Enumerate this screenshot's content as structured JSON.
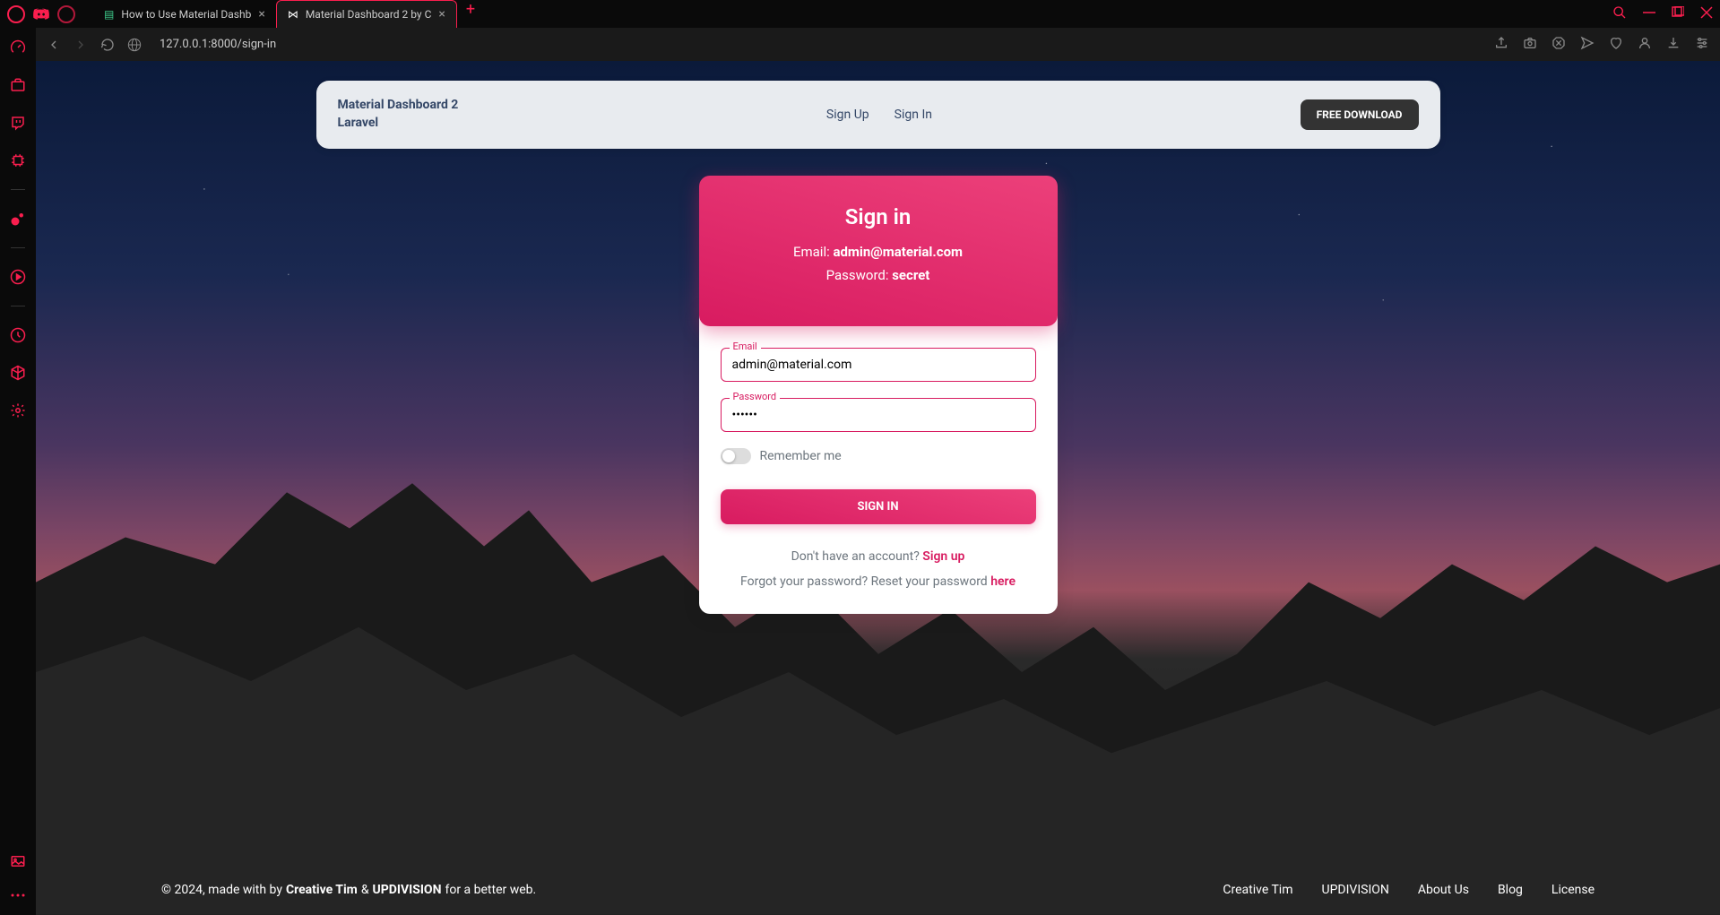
{
  "browser": {
    "tabs": [
      {
        "title": "How to Use Material Dashb",
        "active": false
      },
      {
        "title": "Material Dashboard 2 by C",
        "active": true
      }
    ],
    "url": "127.0.0.1:8000/sign-in"
  },
  "header": {
    "brand_line1": "Material Dashboard 2",
    "brand_line2": "Laravel",
    "nav": {
      "signup": "Sign Up",
      "signin": "Sign In"
    },
    "download": "FREE DOWNLOAD"
  },
  "signin": {
    "title": "Sign in",
    "hint_email_label": "Email: ",
    "hint_email_value": "admin@material.com",
    "hint_password_label": "Password: ",
    "hint_password_value": "secret",
    "email_label": "Email",
    "email_value": "admin@material.com",
    "password_label": "Password",
    "password_value": "••••••",
    "remember_label": "Remember me",
    "button": "SIGN IN",
    "no_account": "Don't have an account? ",
    "signup_link": "Sign up",
    "forgot": "Forgot your password? Reset your password ",
    "here_link": "here"
  },
  "footer": {
    "copyright_prefix": "© 2024, made with by ",
    "creative_tim": "Creative Tim",
    "amp": " & ",
    "updivision": "UPDIVISION",
    "suffix": " for a better web.",
    "links": {
      "creative_tim": "Creative Tim",
      "updivision": "UPDIVISION",
      "about": "About Us",
      "blog": "Blog",
      "license": "License"
    }
  }
}
